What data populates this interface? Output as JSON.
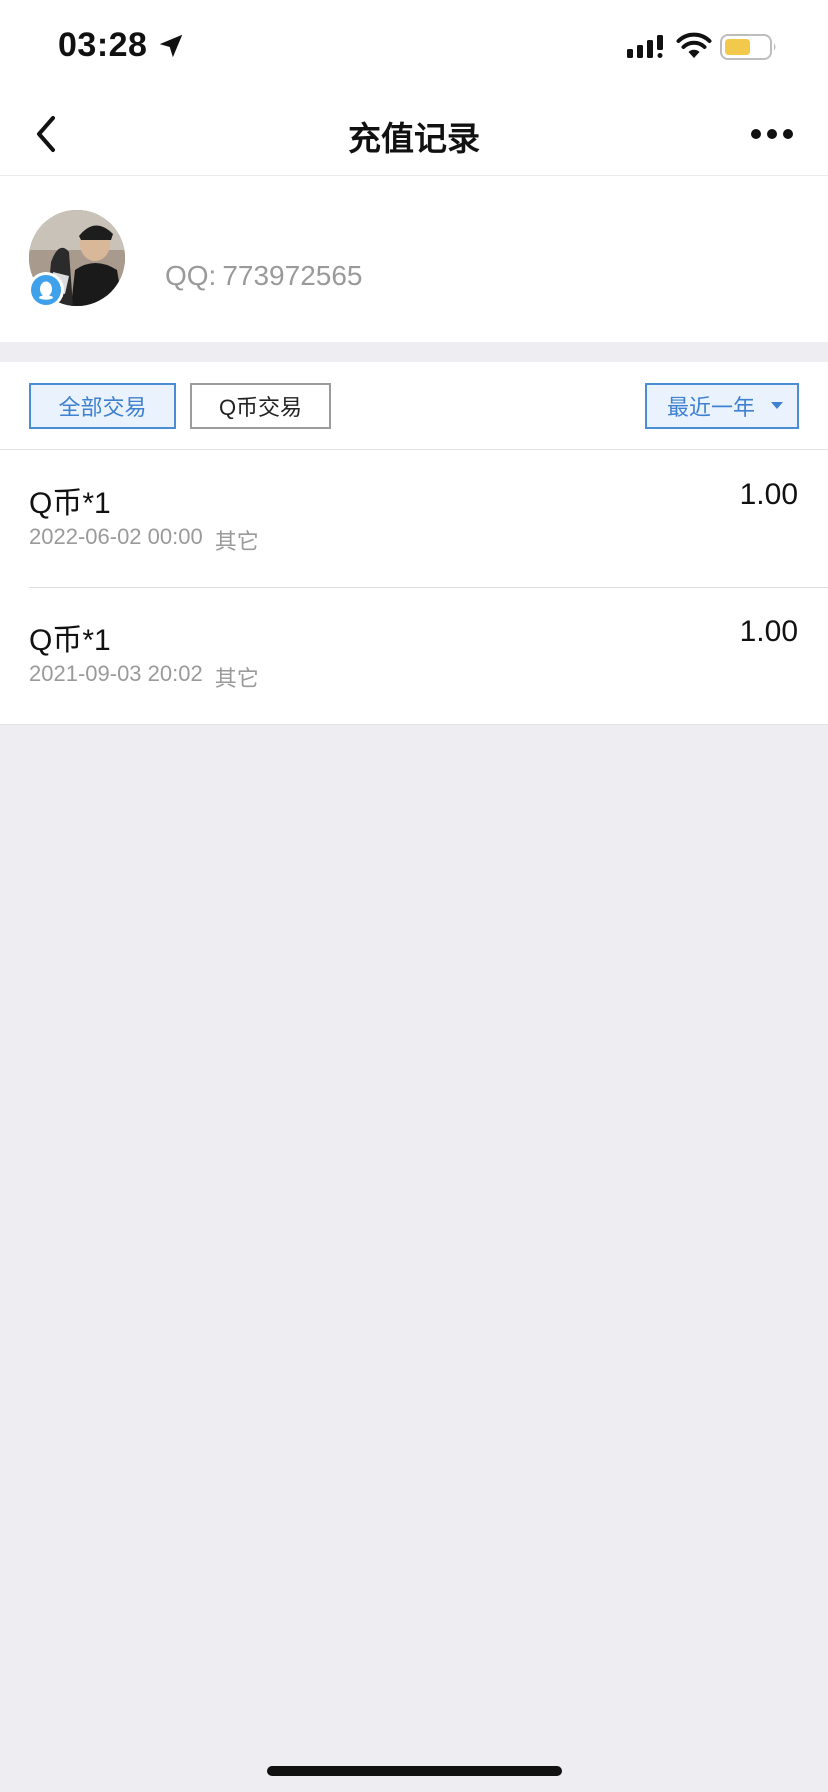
{
  "status_bar": {
    "time": "03:28",
    "icons": [
      "location-arrow-icon",
      "cellular-signal-icon",
      "wifi-icon",
      "battery-icon"
    ],
    "battery_color": "#f3c94b"
  },
  "nav": {
    "title": "充值记录",
    "back_icon": "chevron-left-icon",
    "more_icon": "more-dots-icon"
  },
  "profile": {
    "qq_label": "QQ:",
    "qq_number": "773972565",
    "badge_icon": "qq-penguin-icon"
  },
  "filters": {
    "all_label": "全部交易",
    "qcoin_label": "Q币交易",
    "range_label": "最近一年",
    "active": "全部交易"
  },
  "records": [
    {
      "title": "Q币*1",
      "amount": "1.00",
      "datetime": "2022-06-02 00:00",
      "category": "其它"
    },
    {
      "title": "Q币*1",
      "amount": "1.00",
      "datetime": "2021-09-03 20:02",
      "category": "其它"
    }
  ],
  "colors": {
    "accent": "#3f80d1",
    "page_background": "#ededf2",
    "muted_text": "#9a9a9a"
  }
}
